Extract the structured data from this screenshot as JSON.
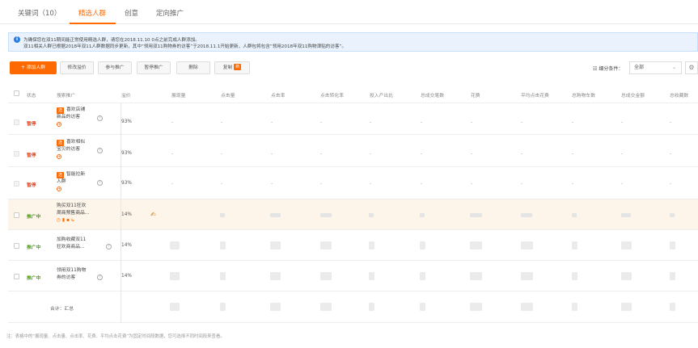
{
  "tabs": [
    {
      "label": "关键词（10）",
      "active": false
    },
    {
      "label": "精选人群",
      "active": true
    },
    {
      "label": "创意",
      "active": false
    },
    {
      "label": "定向推广",
      "active": false
    }
  ],
  "notice": {
    "icon": "info-icon",
    "line1": "为确保您在双11期间能正常使用精选人群，请您在2018.11.10 0点之前完成人群添加。",
    "line2": "双11相关人群已根据2018年双11人群数据同步更新，其中“领用双11购物券的访客”于2018.11.1开始更新，人群包将包含“领用2018年双11购物津贴的访客”。"
  },
  "toolbar": {
    "add": "+ 添加人群",
    "modify_premium": "修改溢价",
    "join": "参与推广",
    "pause": "暂停推广",
    "delete": "删除",
    "copy": "复制",
    "copy_badge": "新",
    "filter_icon": "list-filter-icon",
    "filter_label": "细分条件：",
    "filter_value": "全部",
    "settings_icon": "gear-icon"
  },
  "table": {
    "headers": [
      "状态",
      "搜索推广",
      "溢价",
      "展现量",
      "点击量",
      "点击率",
      "点击转化率",
      "投入产出比",
      "总成交笔数",
      "花费",
      "平均点击花费",
      "总购物车数",
      "总成交金额",
      "总收藏数"
    ],
    "badge": "选",
    "help": "?",
    "dash": "-",
    "rows": [
      {
        "status": "暂停",
        "status_type": "paused",
        "name_l1": "喜欢店铺",
        "name_l2": "新品的访客",
        "premium": "93%"
      },
      {
        "status": "暂停",
        "status_type": "paused",
        "name_l1": "喜欢相似",
        "name_l2": "宝贝的访客",
        "premium": "93%"
      },
      {
        "status": "暂停",
        "status_type": "paused",
        "name_l1": "智能拉新",
        "name_l2": "人群",
        "premium": "93%"
      },
      {
        "status": "推广中",
        "status_type": "active",
        "name_l1": "购买双11狂欢",
        "name_l2": "周商预售商品...",
        "premium": "14%"
      },
      {
        "status": "推广中",
        "status_type": "active",
        "name_l1": "加购收藏双11",
        "name_l2": "狂欢商商品...",
        "premium": "14%"
      },
      {
        "status": "推广中",
        "status_type": "active",
        "name_l1": "领用双11购物",
        "name_l2": "券的访客",
        "premium": "14%"
      }
    ],
    "total_label": "合计：汇总"
  },
  "footer_note": "注：表格中的“展现量、点击量、点击率、花费、平均点击花费”为固定时间段数据，您可选择不同时间段来查看。",
  "colors": {
    "accent": "#ff6a00",
    "paused": "#e2401c",
    "active": "#4aa012",
    "notice_bg": "#eaf3fd"
  }
}
